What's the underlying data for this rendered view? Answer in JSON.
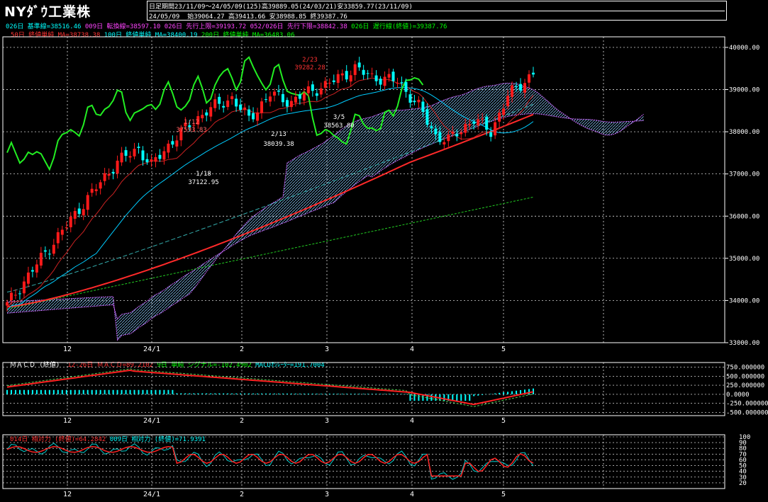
{
  "header": {
    "title": "NYﾀﾞｳ工業株",
    "period_label": "日足",
    "period_info": "期間23/11/09～24/05/09(125)高39889.05(24/03/21)安33859.77(23/11/09)",
    "last_date": "24/05/09",
    "ohlc": "始39064.27 高39413.66 安38988.85 終39387.76"
  },
  "legends": {
    "main1": [
      {
        "text": "026日 基準線=38516.46",
        "color": "#00ffff"
      },
      {
        "text": "009日 転換線=38597.10",
        "color": "#ff44ff"
      },
      {
        "text": "026日 先行上限=39193.72",
        "color": "#ff44ff"
      },
      {
        "text": "052/026日 先行下限=38842.38",
        "color": "#ff44ff"
      },
      {
        "text": "026日 遅行線(終値)=39387.76",
        "color": "#00ff00"
      }
    ],
    "main2": [
      {
        "text": "50日 終値単純 MA=38738.38",
        "color": "#ff3333"
      },
      {
        "text": "100日 終値単純 MA=38400.19",
        "color": "#00ffff"
      },
      {
        "text": "200日 終値単純 MA=36483.06",
        "color": "#00ff00"
      }
    ],
    "macd": [
      {
        "text": "ＭＡＣＤ (終値)",
        "color": "#ffffff"
      },
      {
        "text": "12-26日 ＭＡＣＤ=89.2102",
        "color": "#ff3333"
      },
      {
        "text": "9日 単純 シグナル=-102.4902",
        "color": "#00ff00"
      },
      {
        "text": "MACDｵｼﾚｰﾀｰ=191.7004",
        "color": "#00ffff"
      }
    ],
    "rsi": [
      {
        "text": "014日 相対力 (終値)=64.2842",
        "color": "#ff3333"
      },
      {
        "text": "009日 相対力 (終値)=71.9391",
        "color": "#00ffff"
      }
    ]
  },
  "chart_data": [
    {
      "type": "candlestick",
      "name": "price",
      "y_ticks": [
        "40000.00",
        "39000.00",
        "38000.00",
        "37000.00",
        "36000.00",
        "35000.00",
        "34000.00",
        "33000.00"
      ],
      "ylim": [
        33000,
        40200
      ],
      "x_ticks": [
        "12",
        "24/1",
        "2",
        "3",
        "4",
        "5"
      ],
      "annotations": [
        {
          "text": "1/12",
          "value": 37593.83
        },
        {
          "text": "37593.83",
          "value": 37593.83
        },
        {
          "text": "1/18",
          "value": 37122.95
        },
        {
          "text": "37122.95",
          "value": 37122.95
        },
        {
          "text": "2/13",
          "value": 38039.38
        },
        {
          "text": "38039.38",
          "value": 38039.38
        },
        {
          "text": "3/5",
          "value": 38563.8
        },
        {
          "text": "38563.80",
          "value": 38563.8
        },
        {
          "text": "2/23",
          "value": 39282.28
        },
        {
          "text": "39282.28",
          "value": 39282.28
        }
      ]
    },
    {
      "type": "line",
      "name": "macd",
      "y_ticks": [
        "750.000000",
        "500.000000",
        "250.000000",
        "0.0000",
        "-250.000000",
        "-500.000000"
      ],
      "ylim": [
        -550,
        800
      ],
      "x_ticks": [
        "12",
        "24/1",
        "2",
        "3",
        "4",
        "5"
      ]
    },
    {
      "type": "line",
      "name": "rsi",
      "y_ticks": [
        "100",
        "90",
        "80",
        "70",
        "60",
        "50",
        "40",
        "30",
        "20"
      ],
      "ylim": [
        10,
        100
      ],
      "x_ticks": [
        "12",
        "24/1",
        "2",
        "3",
        "4",
        "5"
      ]
    }
  ],
  "colors": {
    "up": "#ff1a1a",
    "down": "#00ffff",
    "grid": "#ffffff",
    "ma50": "#ff2a2a",
    "ma100": "#00ccff",
    "ma200": "#22cc22",
    "chikou": "#22ee22",
    "kumo": "#cc66ff"
  }
}
